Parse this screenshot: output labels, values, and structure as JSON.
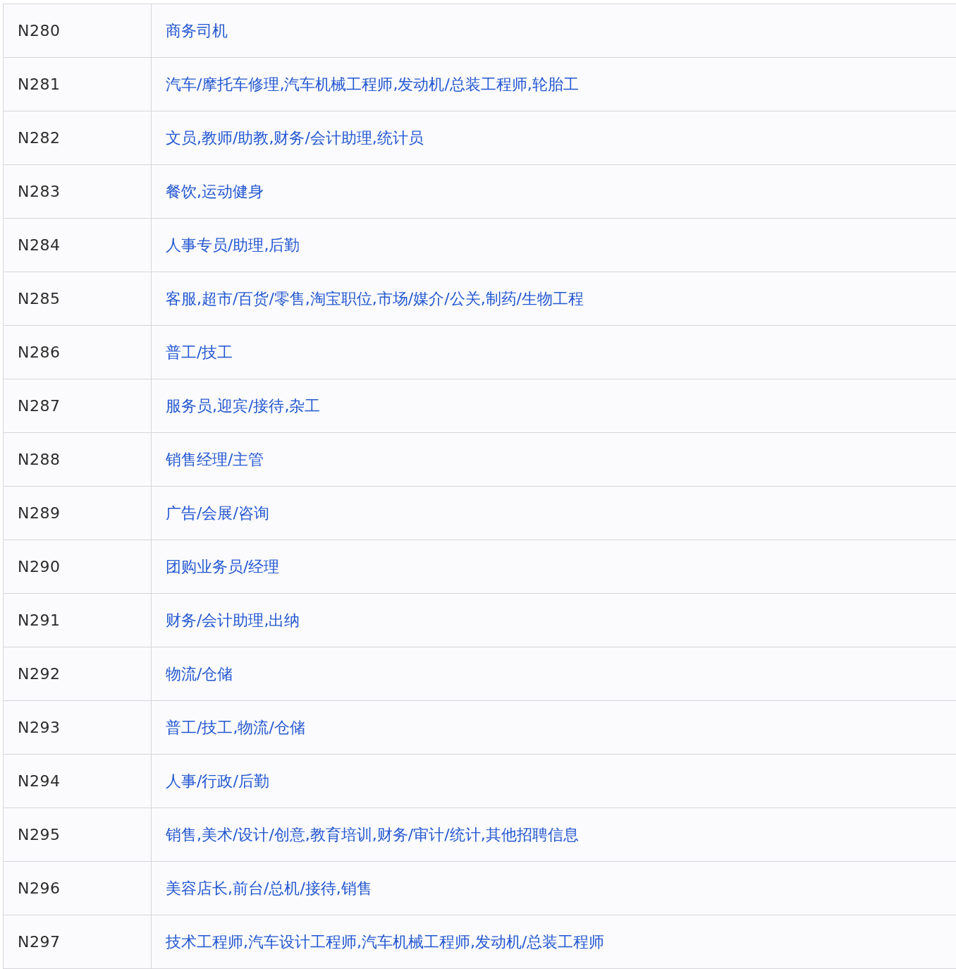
{
  "table": {
    "rows": [
      {
        "code": "N280",
        "jobs": "商务司机"
      },
      {
        "code": "N281",
        "jobs": "汽车/摩托车修理,汽车机械工程师,发动机/总装工程师,轮胎工"
      },
      {
        "code": "N282",
        "jobs": "文员,教师/助教,财务/会计助理,统计员"
      },
      {
        "code": "N283",
        "jobs": "餐饮,运动健身"
      },
      {
        "code": "N284",
        "jobs": "人事专员/助理,后勤"
      },
      {
        "code": "N285",
        "jobs": "客服,超市/百货/零售,淘宝职位,市场/媒介/公关,制药/生物工程"
      },
      {
        "code": "N286",
        "jobs": "普工/技工"
      },
      {
        "code": "N287",
        "jobs": "服务员,迎宾/接待,杂工"
      },
      {
        "code": "N288",
        "jobs": "销售经理/主管"
      },
      {
        "code": "N289",
        "jobs": "广告/会展/咨询"
      },
      {
        "code": "N290",
        "jobs": "团购业务员/经理"
      },
      {
        "code": "N291",
        "jobs": "财务/会计助理,出纳"
      },
      {
        "code": "N292",
        "jobs": "物流/仓储"
      },
      {
        "code": "N293",
        "jobs": "普工/技工,物流/仓储"
      },
      {
        "code": "N294",
        "jobs": "人事/行政/后勤"
      },
      {
        "code": "N295",
        "jobs": "销售,美术/设计/创意,教育培训,财务/审计/统计,其他招聘信息"
      },
      {
        "code": "N296",
        "jobs": "美容店长,前台/总机/接待,销售"
      },
      {
        "code": "N297",
        "jobs": "技术工程师,汽车设计工程师,汽车机械工程师,发动机/总装工程师"
      }
    ]
  }
}
